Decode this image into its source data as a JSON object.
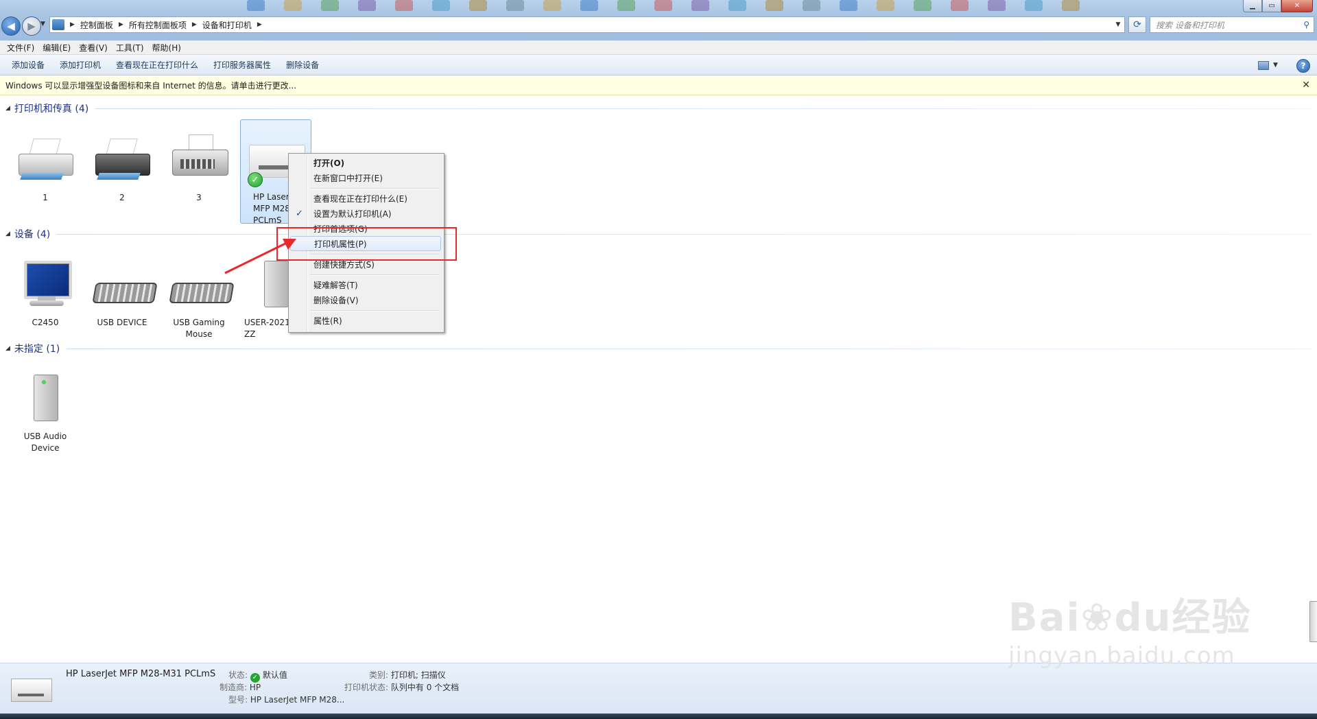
{
  "address_bar": {
    "breadcrumbs": [
      "控制面板",
      "所有控制面板项",
      "设备和打印机"
    ],
    "search_placeholder": "搜索 设备和打印机"
  },
  "menubar": [
    "文件(F)",
    "编辑(E)",
    "查看(V)",
    "工具(T)",
    "帮助(H)"
  ],
  "commandbar": [
    "添加设备",
    "添加打印机",
    "查看现在正在打印什么",
    "打印服务器属性",
    "删除设备"
  ],
  "infobar": {
    "text": "Windows 可以显示增强型设备图标和来自 Internet 的信息。请单击进行更改..."
  },
  "groups": [
    {
      "title": "打印机和传真 (4)",
      "items": [
        {
          "label": "1",
          "icon": "printer-icon"
        },
        {
          "label": "2",
          "icon": "printer-icon"
        },
        {
          "label": "3",
          "icon": "fax-icon"
        },
        {
          "label": "HP Laser\nMFP M28-\nPCLmS",
          "icon": "mfp-printer-icon",
          "default": true
        }
      ]
    },
    {
      "title": "设备 (4)",
      "items": [
        {
          "label": "C2450",
          "icon": "monitor-icon"
        },
        {
          "label": "USB DEVICE",
          "icon": "keyboard-icon"
        },
        {
          "label": "USB Gaming\nMouse",
          "icon": "keyboard-icon"
        },
        {
          "label": "USER-2021\nZZ",
          "icon": "computer-tower-icon"
        }
      ]
    },
    {
      "title": "未指定 (1)",
      "items": [
        {
          "label": "USB Audio\nDevice",
          "icon": "computer-tower-icon"
        }
      ]
    }
  ],
  "context_menu": {
    "items": [
      {
        "label": "打开(O)",
        "bold": true
      },
      {
        "label": "在新窗口中打开(E)"
      },
      {
        "label": "查看现在正在打印什么(E)"
      },
      {
        "label": "设置为默认打印机(A)",
        "checked": true
      },
      {
        "label": "打印首选项(G)"
      },
      {
        "label": "打印机属性(P)",
        "highlighted": true
      },
      {
        "label": "创建快捷方式(S)"
      },
      {
        "label": "疑难解答(T)"
      },
      {
        "label": "删除设备(V)"
      },
      {
        "label": "属性(R)"
      }
    ]
  },
  "details": {
    "name": "HP LaserJet MFP M28-M31 PCLmS",
    "status_label": "状态:",
    "status_value": "默认值",
    "maker_label": "制造商:",
    "maker_value": "HP",
    "model_label": "型号:",
    "model_value": "HP LaserJet MFP M28...",
    "category_label": "类别:",
    "category_value": "打印机; 扫描仪",
    "printer_status_label": "打印机状态:",
    "printer_status_value": "队列中有 0 个文档"
  },
  "watermark": {
    "line1": "Bai",
    "paw": "du",
    "line1_cn": "经验",
    "line2": "jingyan.baidu.com"
  },
  "colors": {
    "annotation_red": "#e8282b",
    "group_header": "#1e3287",
    "infobar_bg": "#ffffe1"
  }
}
